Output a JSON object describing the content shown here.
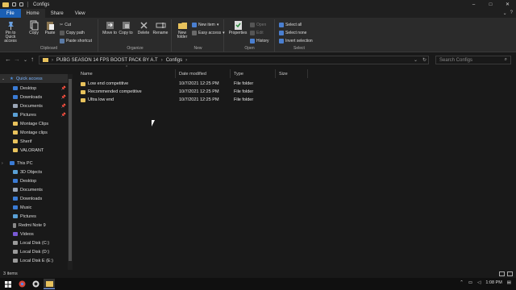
{
  "window": {
    "title": "Configs",
    "controls": {
      "minimize": "–",
      "maximize": "□",
      "close": "✕"
    }
  },
  "ribbon": {
    "tabs": [
      {
        "label": "File"
      },
      {
        "label": "Home"
      },
      {
        "label": "Share"
      },
      {
        "label": "View"
      }
    ],
    "clipboard": {
      "pin_label": "Pin to Quick access",
      "copy_label": "Copy",
      "paste_label": "Paste",
      "cut_label": "Cut",
      "copy_path_label": "Copy path",
      "paste_shortcut_label": "Paste shortcut",
      "group_label": "Clipboard"
    },
    "organize": {
      "move_label": "Move to",
      "copy_to_label": "Copy to",
      "delete_label": "Delete",
      "rename_label": "Rename",
      "group_label": "Organize"
    },
    "new": {
      "new_folder_label": "New folder",
      "new_item_label": "New item",
      "easy_access_label": "Easy access",
      "group_label": "New"
    },
    "open": {
      "properties_label": "Properties",
      "open_label": "Open",
      "edit_label": "Edit",
      "history_label": "History",
      "group_label": "Open"
    },
    "select": {
      "select_all_label": "Select all",
      "select_none_label": "Select none",
      "invert_label": "Invert selection",
      "group_label": "Select"
    }
  },
  "address": {
    "breadcrumbs": [
      "PUBG SEASON 14 FPS BOOST PACK BY A.T",
      "Configs"
    ],
    "search_placeholder": "Search Configs"
  },
  "navpane": {
    "items": [
      {
        "label": "Quick access",
        "icon": "star-icon",
        "pinned": false
      },
      {
        "label": "Desktop",
        "icon": "desktop-icon",
        "pinned": true
      },
      {
        "label": "Downloads",
        "icon": "download-icon",
        "pinned": true
      },
      {
        "label": "Documents",
        "icon": "documents-icon",
        "pinned": true
      },
      {
        "label": "Pictures",
        "icon": "pictures-icon",
        "pinned": true
      },
      {
        "label": "Montage Clips",
        "icon": "folder-icon",
        "pinned": false
      },
      {
        "label": "Montage clips",
        "icon": "folder-icon",
        "pinned": false
      },
      {
        "label": "Sherif",
        "icon": "folder-icon",
        "pinned": false
      },
      {
        "label": "VALORANT",
        "icon": "folder-icon",
        "pinned": false
      },
      {
        "label": "This PC",
        "icon": "pc-icon",
        "pinned": false
      },
      {
        "label": "3D Objects",
        "icon": "cube-icon",
        "pinned": false
      },
      {
        "label": "Desktop",
        "icon": "desktop-icon",
        "pinned": false
      },
      {
        "label": "Documents",
        "icon": "documents-icon",
        "pinned": false
      },
      {
        "label": "Downloads",
        "icon": "download-icon",
        "pinned": false
      },
      {
        "label": "Music",
        "icon": "music-icon",
        "pinned": false
      },
      {
        "label": "Pictures",
        "icon": "pictures-icon",
        "pinned": false
      },
      {
        "label": "Redmi Note 9",
        "icon": "phone-icon",
        "pinned": false
      },
      {
        "label": "Videos",
        "icon": "videos-icon",
        "pinned": false
      },
      {
        "label": "Local Disk (C:)",
        "icon": "disk-icon",
        "pinned": false
      },
      {
        "label": "Local Disk (D:)",
        "icon": "disk-icon",
        "pinned": false
      },
      {
        "label": "Local Disk E (E:)",
        "icon": "disk-icon",
        "pinned": false
      }
    ]
  },
  "filelist": {
    "columns": [
      "Name",
      "Date modified",
      "Type",
      "Size"
    ],
    "rows": [
      {
        "name": "Low end competitive",
        "date": "10/7/2021 12:25 PM",
        "type": "File folder",
        "size": ""
      },
      {
        "name": "Recommended competitive",
        "date": "10/7/2021 12:25 PM",
        "type": "File folder",
        "size": ""
      },
      {
        "name": "Ultra low end",
        "date": "10/7/2021 12:25 PM",
        "type": "File folder",
        "size": ""
      }
    ]
  },
  "status": {
    "item_count": "3 items"
  },
  "taskbar": {
    "time": "1:08 PM"
  },
  "colors": {
    "accent": "#1a5fb4",
    "folder": "#e8c25c",
    "background": "#191919"
  }
}
